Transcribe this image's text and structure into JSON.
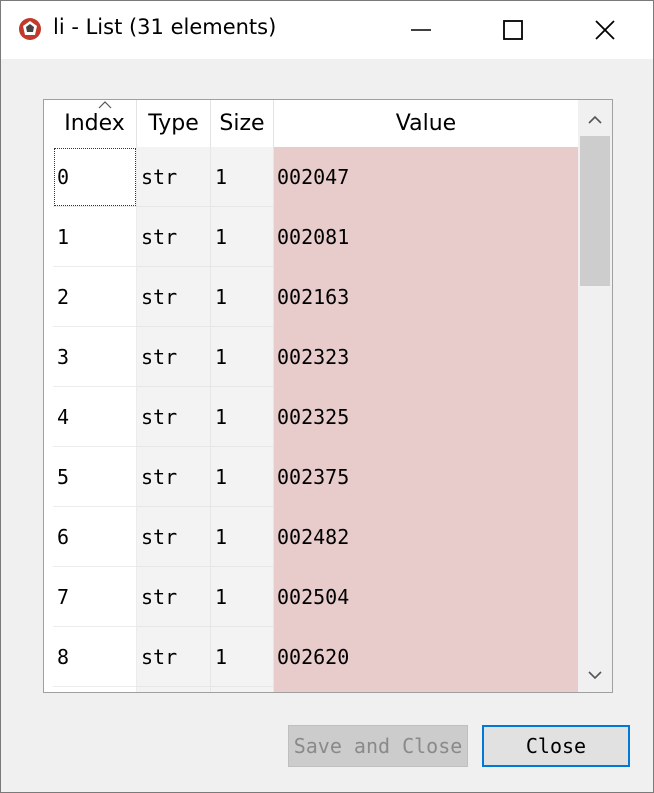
{
  "window": {
    "title": "li - List (31 elements)",
    "app_icon": "spyder-icon",
    "controls": [
      "minimize-icon",
      "maximize-icon",
      "close-icon"
    ]
  },
  "table": {
    "headers": [
      "Index",
      "Type",
      "Size",
      "Value"
    ],
    "sorted_column": "Index",
    "rows": [
      {
        "index": "0",
        "type": "str",
        "size": "1",
        "value": "002047"
      },
      {
        "index": "1",
        "type": "str",
        "size": "1",
        "value": "002081"
      },
      {
        "index": "2",
        "type": "str",
        "size": "1",
        "value": "002163"
      },
      {
        "index": "3",
        "type": "str",
        "size": "1",
        "value": "002323"
      },
      {
        "index": "4",
        "type": "str",
        "size": "1",
        "value": "002325"
      },
      {
        "index": "5",
        "type": "str",
        "size": "1",
        "value": "002375"
      },
      {
        "index": "6",
        "type": "str",
        "size": "1",
        "value": "002482"
      },
      {
        "index": "7",
        "type": "str",
        "size": "1",
        "value": "002504"
      },
      {
        "index": "8",
        "type": "str",
        "size": "1",
        "value": "002620"
      },
      {
        "index": "",
        "type": "",
        "size": "",
        "value": ""
      }
    ],
    "value_color": "#e8cccc"
  },
  "buttons": {
    "save_close": "Save and Close",
    "close": "Close"
  },
  "colors": {
    "accent": "#0078d7"
  }
}
